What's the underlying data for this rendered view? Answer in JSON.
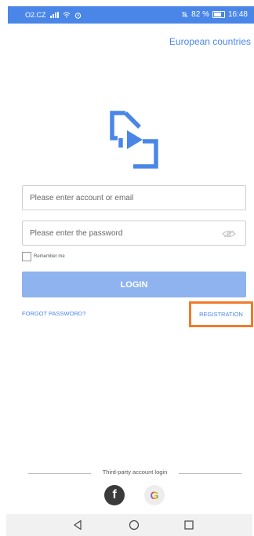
{
  "status_bar": {
    "carrier": "O2.CZ",
    "battery_percent": "82 %",
    "time": "16:48",
    "color": "#4a86e8"
  },
  "header": {
    "region_link": "European countries"
  },
  "logo": {
    "icon": "app-logo-icon",
    "color": "#4a86e8"
  },
  "form": {
    "account_placeholder": "Please enter account or email",
    "account_value": "",
    "password_placeholder": "Please enter the password",
    "password_value": "",
    "remember_label": "Remember me",
    "remember_checked": false,
    "login_label": "LOGIN",
    "login_color": "#8fb3ef"
  },
  "links": {
    "forgot_password": "FORGOT PASSWORD?",
    "registration": "REGISTRATION",
    "highlight_color": "#f07c2a"
  },
  "third_party": {
    "label": "Third-party account login",
    "providers": [
      {
        "name": "facebook",
        "icon": "facebook-icon",
        "glyph": "f"
      },
      {
        "name": "google",
        "icon": "google-icon",
        "glyph": "G"
      }
    ]
  },
  "nav_bar": {
    "buttons": [
      "back-icon",
      "home-icon",
      "recents-icon"
    ]
  }
}
